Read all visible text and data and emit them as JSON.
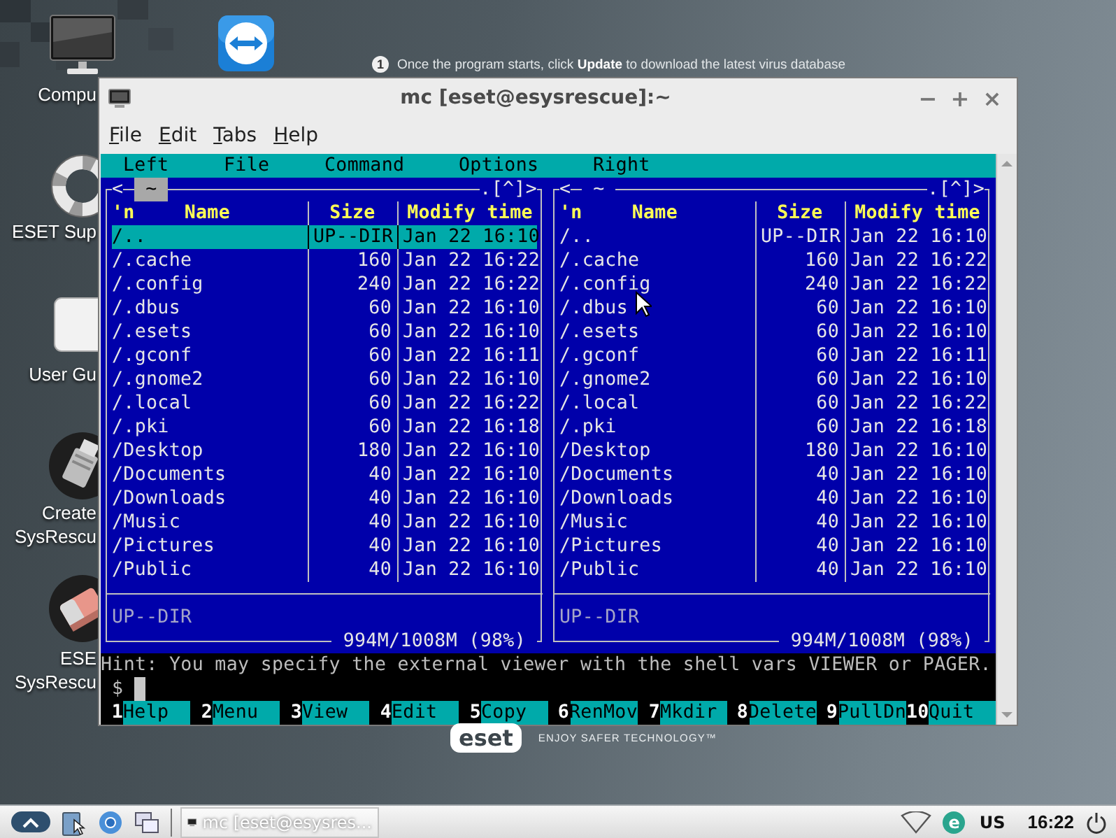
{
  "desktop": {
    "icons": [
      {
        "label": [
          "Compu"
        ]
      },
      {
        "label": [
          "ESET Sup"
        ]
      },
      {
        "label": [
          "User Gu"
        ]
      },
      {
        "label": [
          "Create",
          "SysRescu"
        ]
      },
      {
        "label": [
          "ESE",
          "SysRescu"
        ]
      }
    ],
    "notification": {
      "number": "1",
      "text": "Once the program starts, click **Update** to download the latest virus database"
    },
    "brand": {
      "logo": "eset",
      "tagline": "ENJOY SAFER TECHNOLOGY™"
    }
  },
  "window": {
    "title": "mc [eset@esysrescue]:~",
    "controls": [
      "−",
      "+",
      "×"
    ],
    "menu": [
      "File",
      "Edit",
      "Tabs",
      "Help"
    ]
  },
  "mc": {
    "menubar": [
      "Left",
      "File",
      "Command",
      "Options",
      "Right"
    ],
    "panels": [
      {
        "left_mark": "<",
        "path": "~",
        "active": true,
        "right_mark": ".[^]>",
        "columns": [
          "'n",
          "Name",
          "Size",
          "Modify time"
        ],
        "rows": [
          {
            "name": "/..",
            "size": "UP--DIR",
            "time": "Jan 22 16:10",
            "selected": true
          },
          {
            "name": "/.cache",
            "size": "160",
            "time": "Jan 22 16:22",
            "selected": false
          },
          {
            "name": "/.config",
            "size": "240",
            "time": "Jan 22 16:22",
            "selected": false
          },
          {
            "name": "/.dbus",
            "size": "60",
            "time": "Jan 22 16:10",
            "selected": false
          },
          {
            "name": "/.esets",
            "size": "60",
            "time": "Jan 22 16:10",
            "selected": false
          },
          {
            "name": "/.gconf",
            "size": "60",
            "time": "Jan 22 16:11",
            "selected": false
          },
          {
            "name": "/.gnome2",
            "size": "60",
            "time": "Jan 22 16:10",
            "selected": false
          },
          {
            "name": "/.local",
            "size": "60",
            "time": "Jan 22 16:22",
            "selected": false
          },
          {
            "name": "/.pki",
            "size": "60",
            "time": "Jan 22 16:18",
            "selected": false
          },
          {
            "name": "/Desktop",
            "size": "180",
            "time": "Jan 22 16:10",
            "selected": false
          },
          {
            "name": "/Documents",
            "size": "40",
            "time": "Jan 22 16:10",
            "selected": false
          },
          {
            "name": "/Downloads",
            "size": "40",
            "time": "Jan 22 16:10",
            "selected": false
          },
          {
            "name": "/Music",
            "size": "40",
            "time": "Jan 22 16:10",
            "selected": false
          },
          {
            "name": "/Pictures",
            "size": "40",
            "time": "Jan 22 16:10",
            "selected": false
          },
          {
            "name": "/Public",
            "size": "40",
            "time": "Jan 22 16:10",
            "selected": false
          }
        ],
        "status": "UP--DIR",
        "free": "994M/1008M (98%)"
      },
      {
        "left_mark": "<",
        "path": "~",
        "active": false,
        "right_mark": ".[^]>",
        "columns": [
          "'n",
          "Name",
          "Size",
          "Modify time"
        ],
        "rows": [
          {
            "name": "/..",
            "size": "UP--DIR",
            "time": "Jan 22 16:10",
            "selected": false
          },
          {
            "name": "/.cache",
            "size": "160",
            "time": "Jan 22 16:22",
            "selected": false
          },
          {
            "name": "/.config",
            "size": "240",
            "time": "Jan 22 16:22",
            "selected": false
          },
          {
            "name": "/.dbus",
            "size": "60",
            "time": "Jan 22 16:10",
            "selected": false
          },
          {
            "name": "/.esets",
            "size": "60",
            "time": "Jan 22 16:10",
            "selected": false
          },
          {
            "name": "/.gconf",
            "size": "60",
            "time": "Jan 22 16:11",
            "selected": false
          },
          {
            "name": "/.gnome2",
            "size": "60",
            "time": "Jan 22 16:10",
            "selected": false
          },
          {
            "name": "/.local",
            "size": "60",
            "time": "Jan 22 16:22",
            "selected": false
          },
          {
            "name": "/.pki",
            "size": "60",
            "time": "Jan 22 16:18",
            "selected": false
          },
          {
            "name": "/Desktop",
            "size": "180",
            "time": "Jan 22 16:10",
            "selected": false
          },
          {
            "name": "/Documents",
            "size": "40",
            "time": "Jan 22 16:10",
            "selected": false
          },
          {
            "name": "/Downloads",
            "size": "40",
            "time": "Jan 22 16:10",
            "selected": false
          },
          {
            "name": "/Music",
            "size": "40",
            "time": "Jan 22 16:10",
            "selected": false
          },
          {
            "name": "/Pictures",
            "size": "40",
            "time": "Jan 22 16:10",
            "selected": false
          },
          {
            "name": "/Public",
            "size": "40",
            "time": "Jan 22 16:10",
            "selected": false
          }
        ],
        "status": "UP--DIR",
        "free": "994M/1008M (98%)"
      }
    ],
    "hint": "Hint: You may specify the external viewer with the shell vars VIEWER or PAGER.",
    "prompt": "$",
    "keys": [
      {
        "number": "1",
        "label": "Help"
      },
      {
        "number": "2",
        "label": "Menu"
      },
      {
        "number": "3",
        "label": "View"
      },
      {
        "number": "4",
        "label": "Edit"
      },
      {
        "number": "5",
        "label": "Copy"
      },
      {
        "number": "6",
        "label": "RenMov"
      },
      {
        "number": "7",
        "label": "Mkdir"
      },
      {
        "number": "8",
        "label": "Delete"
      },
      {
        "number": "9",
        "label": "PullDn"
      },
      {
        "number": "10",
        "label": "Quit"
      }
    ]
  },
  "taskbar": {
    "task": "mc [eset@esysres...",
    "tray_app": "e",
    "layout": "US",
    "clock": "16:22"
  }
}
